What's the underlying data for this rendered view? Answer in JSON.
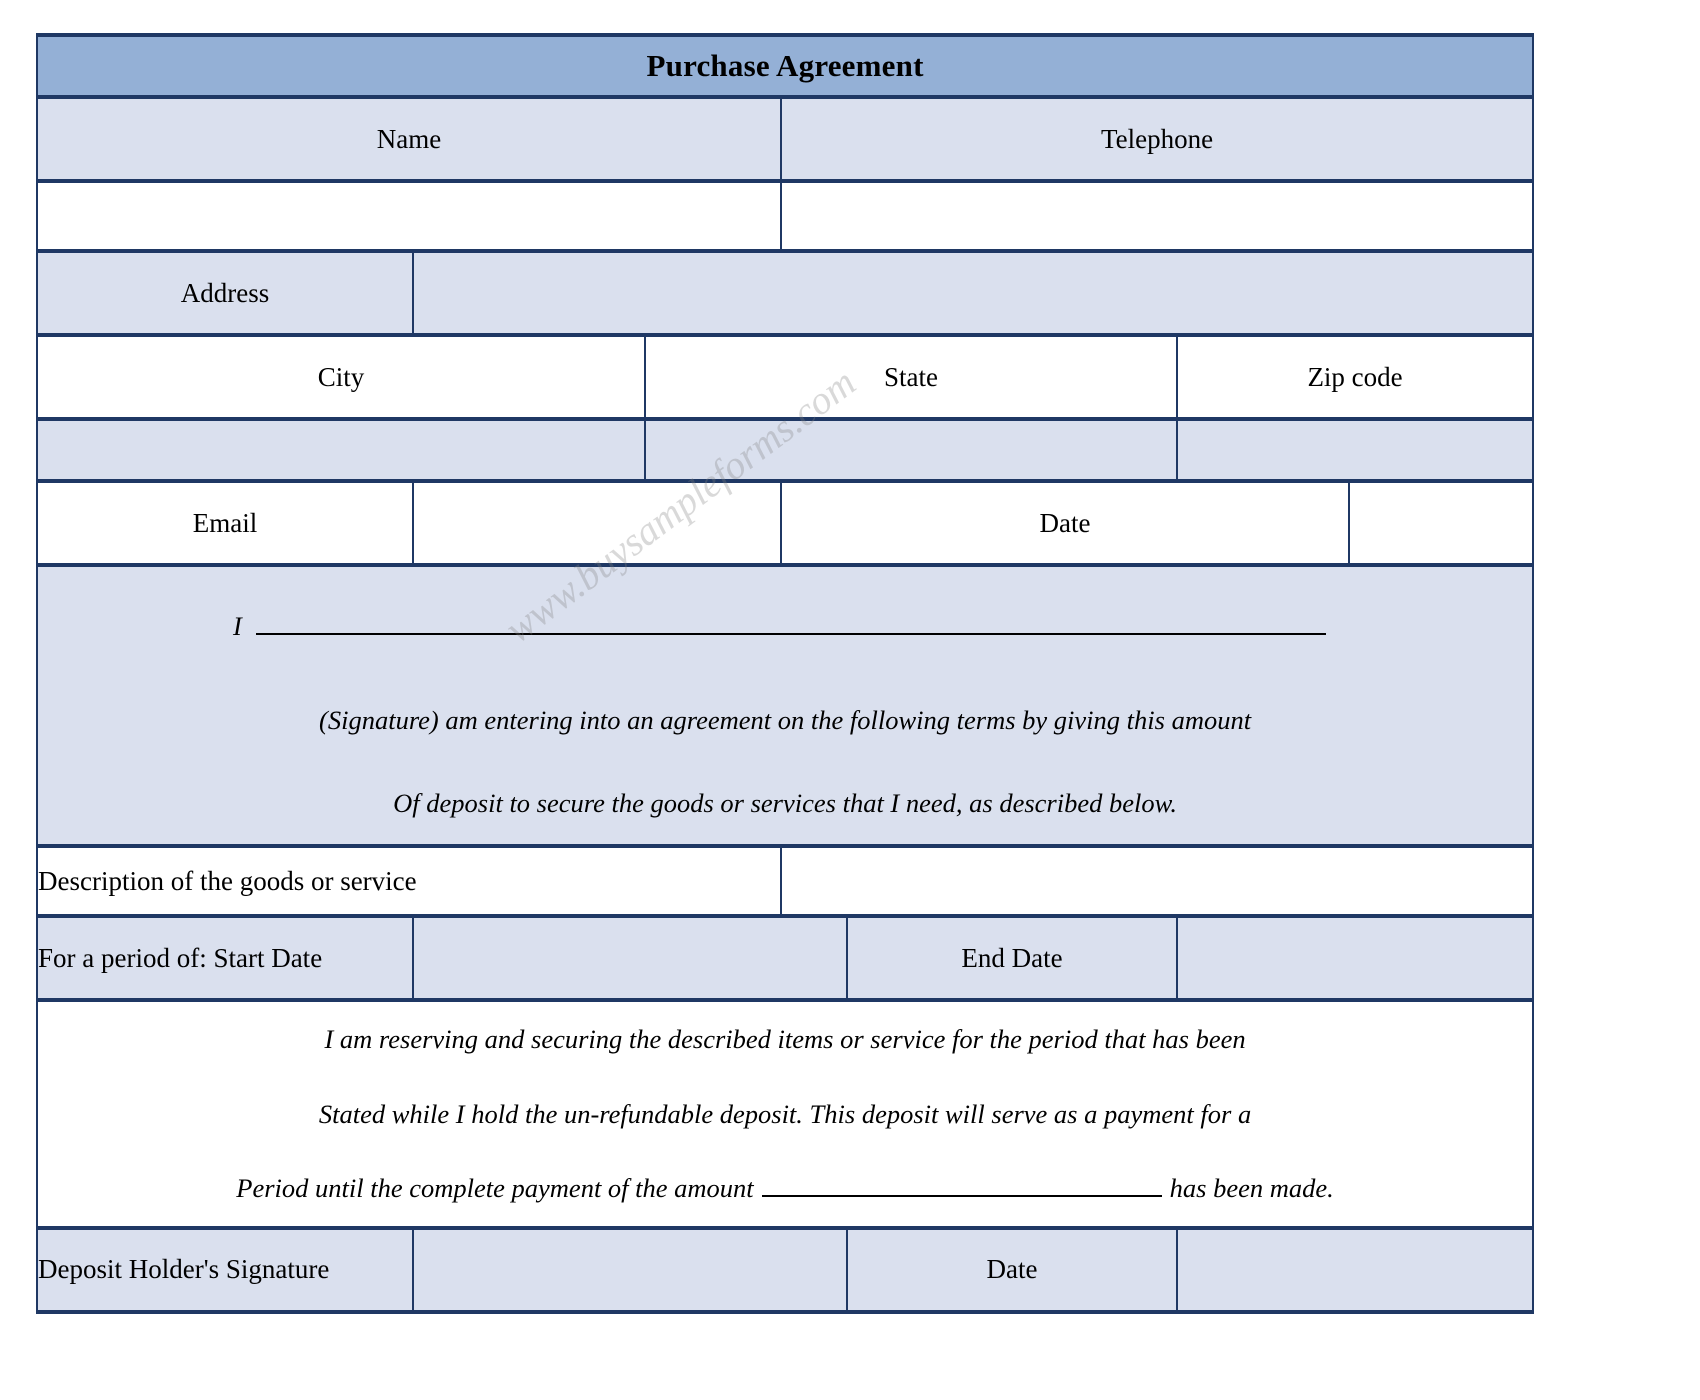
{
  "document": {
    "title": "Purchase Agreement",
    "watermark": "www.buysampleforms.com",
    "colors": {
      "title_bar": "#94b0d6",
      "shaded_cell": "#dae0ee",
      "border": "#1f3864",
      "text": "#000000"
    }
  },
  "fields": {
    "name_label": "Name",
    "telephone_label": "Telephone",
    "address_label": "Address",
    "city_label": "City",
    "state_label": "State",
    "zip_label": "Zip code",
    "email_label": "Email",
    "date_label": "Date",
    "name_value": "",
    "telephone_value": "",
    "address_value": "",
    "city_value": "",
    "state_value": "",
    "zip_value": "",
    "email_value": "",
    "date_value": ""
  },
  "agreement": {
    "pronoun": "I",
    "signature_line_value": "",
    "line2": "(Signature) am entering into an agreement on the following terms by giving this amount",
    "line3": "Of deposit to secure the goods or services that I need, as described below."
  },
  "goods": {
    "description_label": "Description of the goods or service",
    "description_value": ""
  },
  "period": {
    "start_label": "For a period of: Start Date",
    "start_value": "",
    "end_label": "End Date",
    "end_value": ""
  },
  "terms": {
    "line1": "I am reserving and securing the described items or service for the period that has been",
    "line2": "Stated while I hold the un-refundable deposit. This deposit will serve as a payment for a",
    "line3_before": "Period until the complete payment of the amount",
    "amount_value": "",
    "line3_after": "has been made."
  },
  "footer": {
    "signature_label": "Deposit Holder's Signature",
    "signature_value": "",
    "date_label": "Date",
    "date_value": ""
  }
}
